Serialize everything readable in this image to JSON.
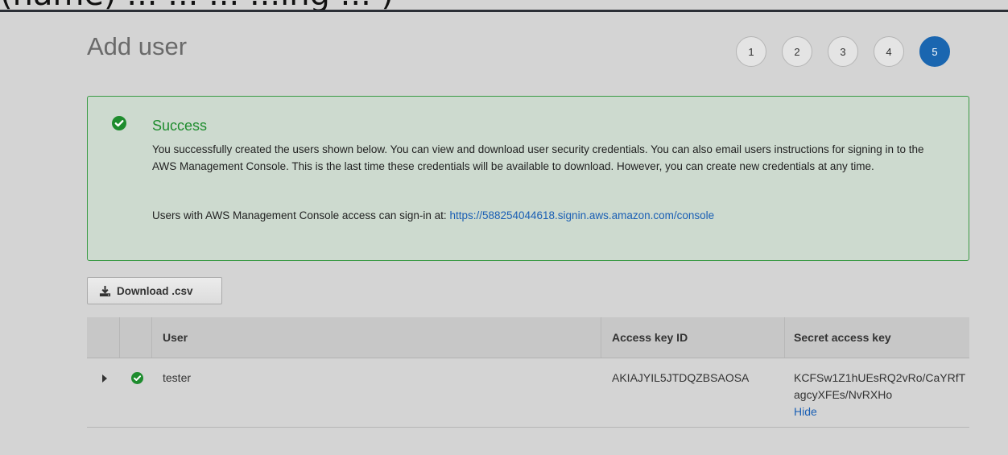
{
  "topbar": {
    "partial_text": "(name) ... ... ... ...ing ... )"
  },
  "page": {
    "title": "Add user"
  },
  "steps": [
    {
      "label": "1",
      "active": false
    },
    {
      "label": "2",
      "active": false
    },
    {
      "label": "3",
      "active": false
    },
    {
      "label": "4",
      "active": false
    },
    {
      "label": "5",
      "active": true
    }
  ],
  "alert": {
    "icon": "check-circle-icon",
    "title": "Success",
    "body": "You successfully created the users shown below. You can view and download user security credentials. You can also email users instructions for signing in to the AWS Management Console. This is the last time these credentials will be available to download. However, you can create new credentials at any time.",
    "signin_prefix": "Users with AWS Management Console access can sign-in at:",
    "signin_url": "https://588254044618.signin.aws.amazon.com/console"
  },
  "download": {
    "label": "Download .csv",
    "icon": "download-icon"
  },
  "table": {
    "columns": [
      "User",
      "Access key ID",
      "Secret access key"
    ],
    "rows": [
      {
        "user": "tester",
        "access_key_id": "AKIAJYIL5JTDQZBSAOSA",
        "secret_access_key": "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",
        "hide_label": "Hide"
      }
    ]
  },
  "colors": {
    "success": "#1e8c2e",
    "link": "#1a5fb4",
    "active_step": "#1a66b0"
  }
}
